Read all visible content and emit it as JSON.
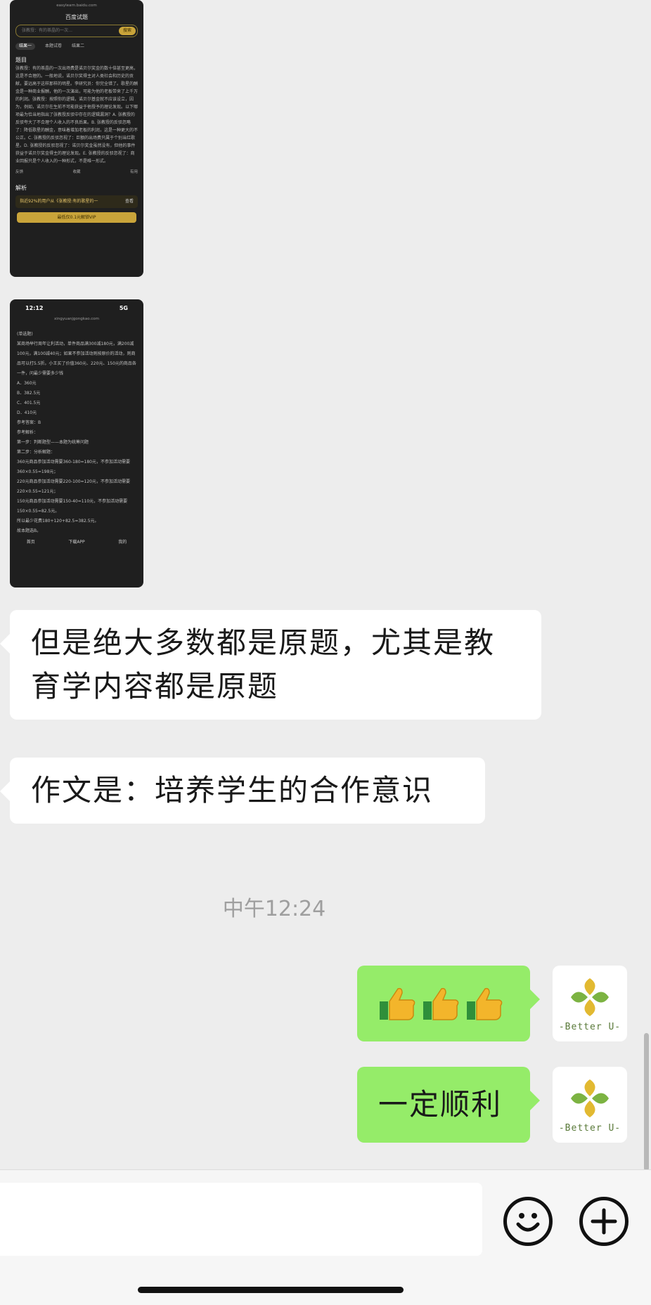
{
  "thumb1": {
    "url": "easylearn.baidu.com",
    "title": "百度试题",
    "search_placeholder": "张教授：有的茶晶的一次…",
    "search_button": "搜索",
    "tabs": [
      "结果一",
      "本题试卷",
      "结果二"
    ],
    "question_heading": "题目",
    "question_text": "张教授：有的茶晶的一次出场费是诺贝尔奖金的数十倍甚至更高，这是不合理的。一般地说，诺贝尔奖得主对人类社会和历史的贡献，要远高于这样那样的明星。李研究员：你完全错了。歌星的酬金是一种商业报酬，他的一次演出，可能为他的老板带来了上千万的利润。张教授：按照你的逻辑，诺贝尔基金就不应该设立，因为，例如，诺贝尔在生前不可能获益于他授予的理论发现。以下哪项最为恰当地指出了张教授反驳中存在的逻辑漏洞？A. 张教授的反驳夸大了不合理个人收入的不良后果。B. 张教授的反驳忽略了：降低歌星的酬金，意味着增加老板的利润，这是一种更大的不公正。C. 张教授的反驳忽视了：巨额的出场费只属于个别当红歌星。D. 张教授的反驳忽视了：诺贝尔奖金虽然没有，但他的事件获益于诺贝尔奖金得主的理论发现。E. 张教授的反驳忽视了：商业回报只是个人收入的一种形式，不是唯一形式。",
    "actions": [
      "反馈",
      "收藏",
      "有用"
    ],
    "analysis_heading": "解析",
    "ad_text": "指近92%的用户从《张教授:有的歌星的一",
    "ad_more": "查看",
    "vip_button": "最低仅0.1元解锁VIP"
  },
  "thumb2": {
    "time": "12:12",
    "signal": "5G",
    "url": "xingyuanjgongkao.com",
    "lines": [
      "(单选题)",
      "某商场举行周年让利活动，单件商品满300减180元，满200减100元，满100减40元；如果不参加活动则按原价的活动，则商品可以打5.5折。小王买了价值360元、220元、150元的商品各一件，问最少需要多少钱",
      "A．360元",
      "B．382.5元",
      "C．401.5元",
      "D．410元",
      "参考答案：B",
      "参考解析：",
      "第一步：判断题型——本题为统筹问题",
      "第二步：分析解题：",
      "360元商品参加活动需要360-180=180元，不参加活动需要360×0.55=198元；",
      "220元商品参加活动需要220-100=120元，不参加活动需要220×0.55=121元；",
      "150元商品参加活动需要150-40=110元，不参加活动需要150×0.55=82.5元。",
      "所以最少花费180+120+82.5=382.5元。",
      "故本题选B。"
    ],
    "nav": [
      "首页",
      "下载APP",
      "我的"
    ]
  },
  "messages": [
    {
      "text": "但是绝大多数都是原题，尤其是教育学内容都是原题"
    },
    {
      "text": "作文是：培养学生的合作意识"
    }
  ],
  "timestamp": "中午12:24",
  "my_messages": [
    {
      "text": ""
    },
    {
      "text": "一定顺利"
    }
  ],
  "avatar_caption": "-Better U-",
  "colors": {
    "bg": "#ededed",
    "bubble_in": "#ffffff",
    "bubble_out": "#95ec69",
    "timestamp": "#9e9e9e"
  },
  "icons": [
    "emoji-icon",
    "plus-icon",
    "thumbs-up-icon"
  ]
}
